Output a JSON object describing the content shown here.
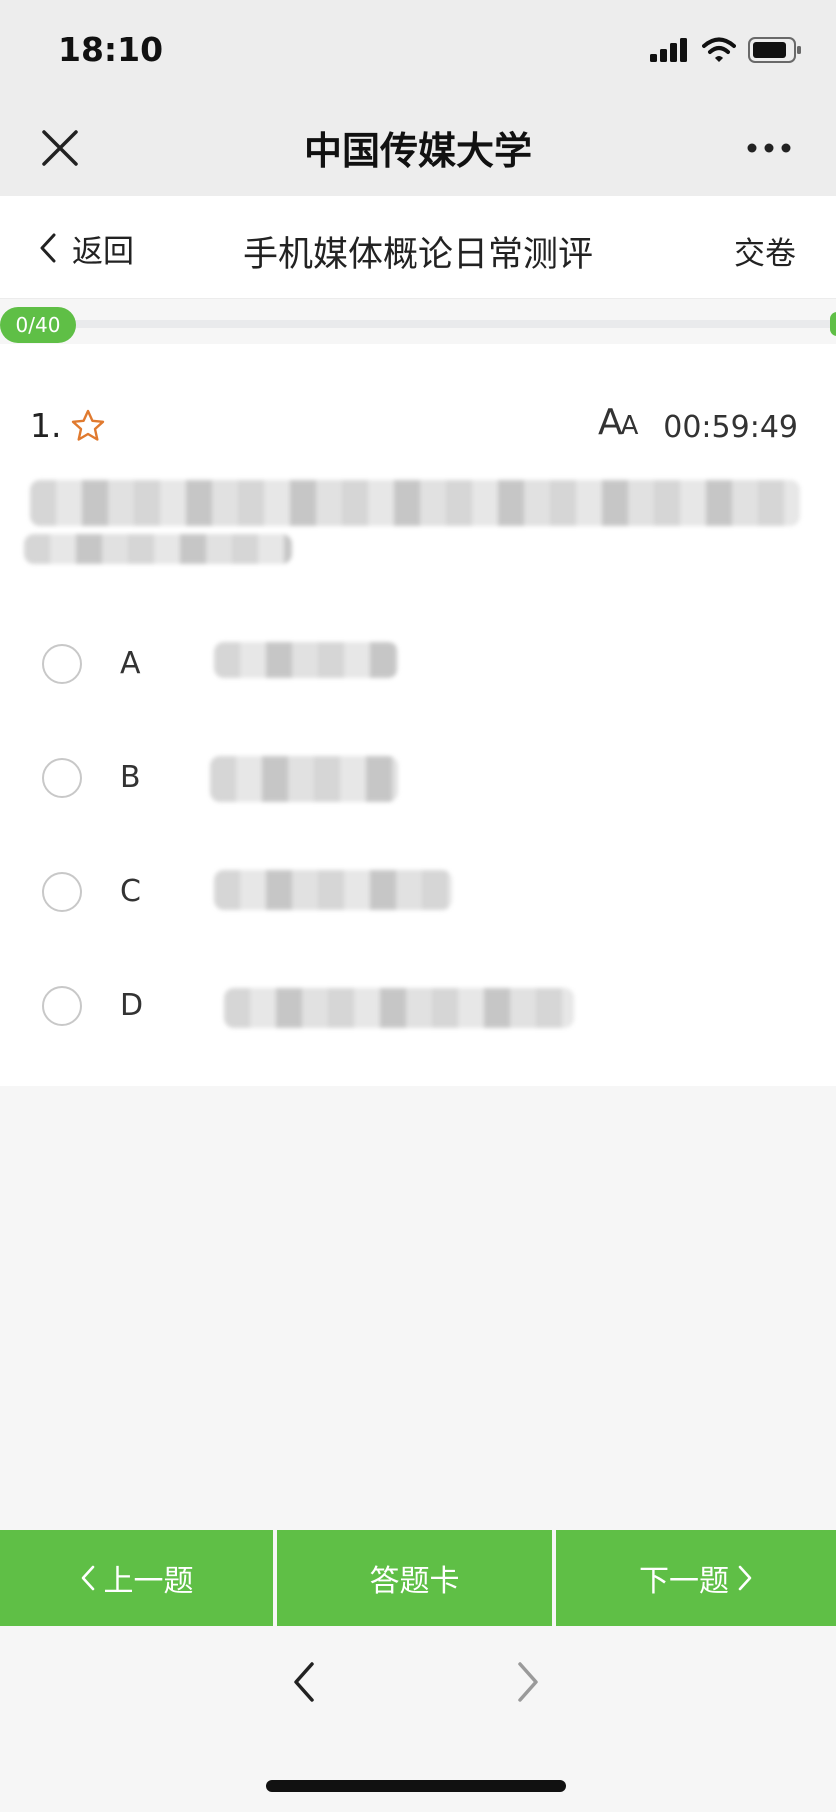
{
  "status_bar": {
    "time": "18:10"
  },
  "wechat_bar": {
    "title": "中国传媒大学"
  },
  "quiz_header": {
    "back_label": "返回",
    "title": "手机媒体概论日常测评",
    "submit_label": "交卷"
  },
  "progress": {
    "label": "0/40",
    "answered": 0,
    "total": 40
  },
  "question": {
    "number": "1.",
    "font_size_label": {
      "big": "A",
      "small": "A"
    },
    "timer": "00:59:49",
    "options": [
      {
        "letter": "A"
      },
      {
        "letter": "B"
      },
      {
        "letter": "C"
      },
      {
        "letter": "D"
      }
    ]
  },
  "bottom_buttons": {
    "prev": "上一题",
    "card": "答题卡",
    "next": "下一题"
  },
  "colors": {
    "accent": "#5fbf46",
    "star": "#e07a2f",
    "bar_bg": "#ededed"
  }
}
